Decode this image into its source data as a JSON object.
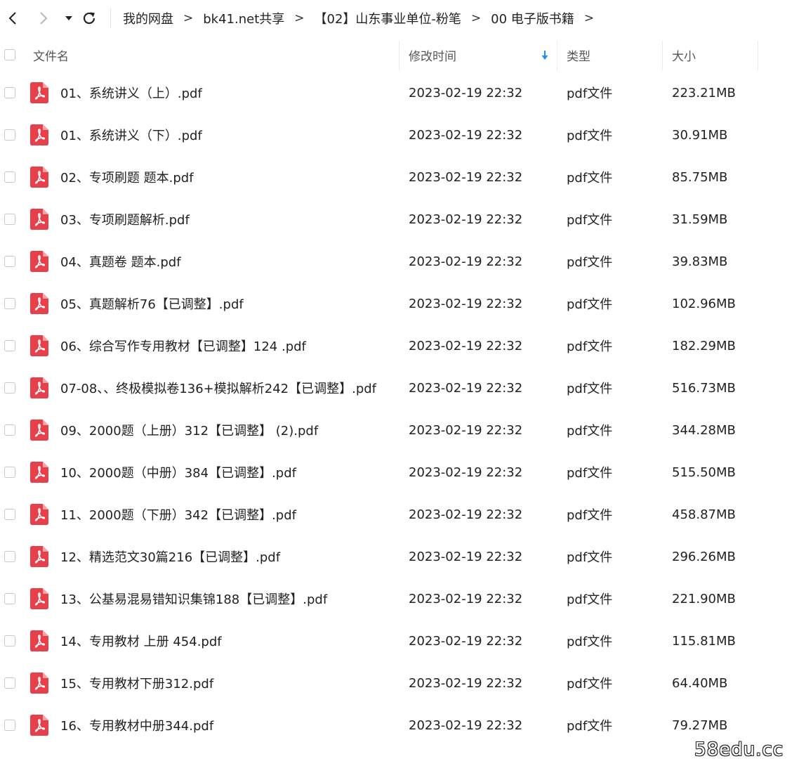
{
  "toolbar": {
    "back_icon": "chevron-left-icon",
    "forward_icon": "chevron-right-icon",
    "history_icon": "caret-down-icon",
    "refresh_icon": "refresh-icon",
    "breadcrumb": [
      "我的网盘",
      "bk41.net共享",
      "【02】山东事业单位-粉笔",
      "00 电子版书籍"
    ],
    "crumb_separator": ">"
  },
  "header": {
    "name": "文件名",
    "modified": "修改时间",
    "type": "类型",
    "size": "大小",
    "sort_icon": "arrow-down-icon",
    "sort_color": "#1a8cff"
  },
  "files": [
    {
      "name": "01、系统讲义（上）.pdf",
      "modified": "2023-02-19 22:32",
      "type": "pdf文件",
      "size": "223.21MB"
    },
    {
      "name": "01、系统讲义（下）.pdf",
      "modified": "2023-02-19 22:32",
      "type": "pdf文件",
      "size": "30.91MB"
    },
    {
      "name": "02、专项刷题 题本.pdf",
      "modified": "2023-02-19 22:32",
      "type": "pdf文件",
      "size": "85.75MB"
    },
    {
      "name": "03、专项刷题解析.pdf",
      "modified": "2023-02-19 22:32",
      "type": "pdf文件",
      "size": "31.59MB"
    },
    {
      "name": "04、真题卷 题本.pdf",
      "modified": "2023-02-19 22:32",
      "type": "pdf文件",
      "size": "39.83MB"
    },
    {
      "name": "05、真题解析76【已调整】.pdf",
      "modified": "2023-02-19 22:32",
      "type": "pdf文件",
      "size": "102.96MB"
    },
    {
      "name": "06、综合写作专用教材【已调整】124 .pdf",
      "modified": "2023-02-19 22:32",
      "type": "pdf文件",
      "size": "182.29MB"
    },
    {
      "name": "07-08、、终极模拟卷136+模拟解析242【已调整】.pdf",
      "modified": "2023-02-19 22:32",
      "type": "pdf文件",
      "size": "516.73MB"
    },
    {
      "name": "09、2000题（上册）312【已调整】 (2).pdf",
      "modified": "2023-02-19 22:32",
      "type": "pdf文件",
      "size": "344.28MB"
    },
    {
      "name": "10、2000题（中册）384【已调整】.pdf",
      "modified": "2023-02-19 22:32",
      "type": "pdf文件",
      "size": "515.50MB"
    },
    {
      "name": "11、2000题（下册）342【已调整】.pdf",
      "modified": "2023-02-19 22:32",
      "type": "pdf文件",
      "size": "458.87MB"
    },
    {
      "name": "12、精选范文30篇216【已调整】.pdf",
      "modified": "2023-02-19 22:32",
      "type": "pdf文件",
      "size": "296.26MB"
    },
    {
      "name": "13、公基易混易错知识集锦188【已调整】.pdf",
      "modified": "2023-02-19 22:32",
      "type": "pdf文件",
      "size": "221.90MB"
    },
    {
      "name": "14、专用教材 上册 454.pdf",
      "modified": "2023-02-19 22:32",
      "type": "pdf文件",
      "size": "115.81MB"
    },
    {
      "name": "15、专用教材下册312.pdf",
      "modified": "2023-02-19 22:32",
      "type": "pdf文件",
      "size": "64.40MB"
    },
    {
      "name": "16、专用教材中册344.pdf",
      "modified": "2023-02-19 22:32",
      "type": "pdf文件",
      "size": "79.27MB"
    }
  ],
  "file_icon": "pdf-file-icon",
  "pdf_icon_color": "#e8404a",
  "watermark": "58edu.cc"
}
